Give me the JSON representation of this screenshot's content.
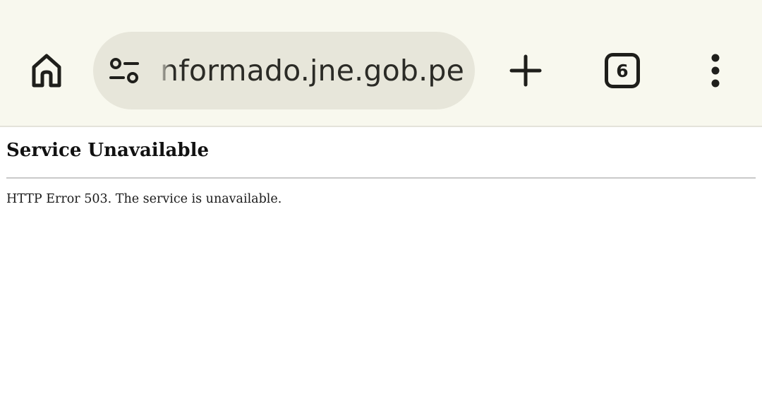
{
  "browser": {
    "url": "informado.jne.gob.pe",
    "tab_count": "6",
    "icons": {
      "home": "home-icon",
      "site_settings": "tune-icon",
      "new_tab": "plus-icon",
      "tabs": "tab-switcher-icon",
      "menu": "more-vert-icon"
    },
    "colors": {
      "toolbar_bg": "#f8f8ee",
      "omnibox_bg": "#e7e6da",
      "icon": "#1f1f1b"
    }
  },
  "page": {
    "title": "Service Unavailable",
    "message": "HTTP Error 503. The service is unavailable."
  }
}
